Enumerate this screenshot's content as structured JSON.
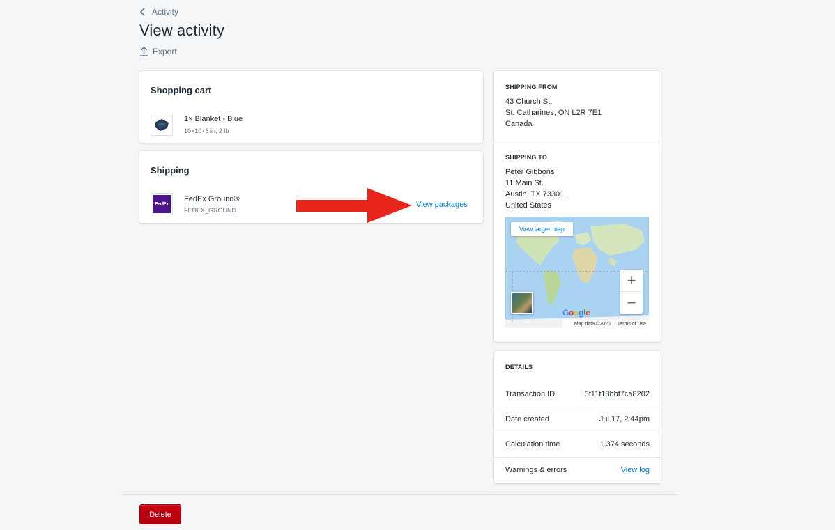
{
  "breadcrumb": {
    "label": "Activity"
  },
  "page": {
    "title": "View activity",
    "export_label": "Export"
  },
  "cart": {
    "title": "Shopping cart",
    "item_name": "1× Blanket - Blue",
    "item_meta": "10×10×6 in, 2 lb"
  },
  "shipping": {
    "title": "Shipping",
    "carrier_name": "FedEx Ground®",
    "carrier_code": "FEDEX_GROUND",
    "carrier_logo_text": "FedEx",
    "view_packages": "View packages"
  },
  "shipping_from": {
    "label": "SHIPPING FROM",
    "line1": "43 Church St.",
    "line2": "St. Catharines, ON L2R 7E1",
    "line3": "Canada"
  },
  "shipping_to": {
    "label": "SHIPPING TO",
    "line1": "Peter Gibbons",
    "line2": "11 Main St.",
    "line3": "Austin, TX 73301",
    "line4": "United States"
  },
  "map": {
    "larger_map": "View larger map",
    "zoom_in": "+",
    "zoom_out": "−",
    "brand": "Google",
    "data_credit": "Map data ©2020",
    "terms": "Terms of Use"
  },
  "details": {
    "label": "DETAILS",
    "rows": [
      {
        "key": "Transaction ID",
        "value": "5f11f18bbf7ca8202"
      },
      {
        "key": "Date created",
        "value": "Jul 17, 2:44pm"
      },
      {
        "key": "Calculation time",
        "value": "1.374 seconds"
      },
      {
        "key": "Warnings & errors",
        "value": "View log"
      }
    ]
  },
  "actions": {
    "delete": "Delete"
  },
  "colors": {
    "link": "#007ace",
    "danger": "#bf0711",
    "arrow": "#e8251b",
    "fedex": "#4d148c"
  }
}
